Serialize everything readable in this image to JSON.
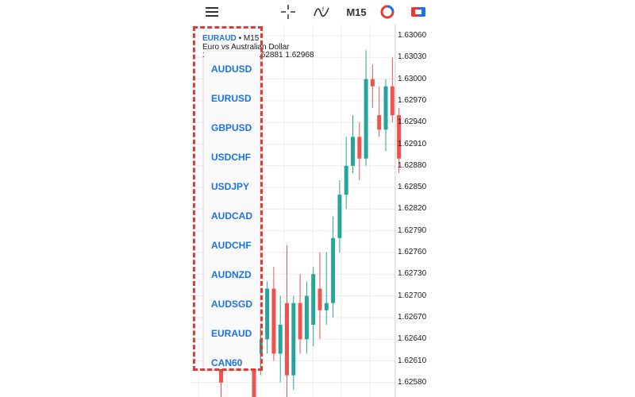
{
  "toolbar": {
    "timeframe": "M15"
  },
  "chart": {
    "symbol": "EURAUD",
    "separator": "•",
    "timeframe": "M15",
    "description": "Euro vs Australian Dollar",
    "ohlc_prefix": "1",
    "ohlc_values": "04 1.62881 1.62968",
    "price_axis": [
      "1.63060",
      "1.63030",
      "1.63000",
      "1.62970",
      "1.62940",
      "1.62910",
      "1.62880",
      "1.62850",
      "1.62820",
      "1.62790",
      "1.62760",
      "1.62730",
      "1.62700",
      "1.62670",
      "1.62640",
      "1.62610",
      "1.62580"
    ]
  },
  "symbol_menu": {
    "items": [
      "AUDUSD",
      "EURUSD",
      "GBPUSD",
      "USDCHF",
      "USDJPY",
      "AUDCAD",
      "AUDCHF",
      "AUDNZD",
      "AUDSGD",
      "EURAUD",
      "CAN60"
    ]
  },
  "colors": {
    "bull": "#26a69a",
    "bear": "#ef5350",
    "grid": "#ececec",
    "accent": "#1a73e8",
    "highlight": "#e53935"
  },
  "chart_data": {
    "type": "candlestick",
    "ylim": [
      1.6256,
      1.6308
    ],
    "candles": [
      {
        "o": 1.626,
        "h": 1.6261,
        "l": 1.6256,
        "c": 1.6258,
        "bull": false
      },
      {
        "o": 1.6272,
        "h": 1.6274,
        "l": 1.627,
        "c": 1.6271,
        "bull": false
      },
      {
        "o": 1.627,
        "h": 1.6272,
        "l": 1.6268,
        "c": 1.6269,
        "bull": false
      },
      {
        "o": 1.6271,
        "h": 1.6273,
        "l": 1.6269,
        "c": 1.627,
        "bull": false
      },
      {
        "o": 1.627,
        "h": 1.6272,
        "l": 1.6263,
        "c": 1.6266,
        "bull": false
      },
      {
        "o": 1.626,
        "h": 1.6264,
        "l": 1.6255,
        "c": 1.6256,
        "bull": false
      },
      {
        "o": 1.6262,
        "h": 1.6266,
        "l": 1.6259,
        "c": 1.6264,
        "bull": true
      },
      {
        "o": 1.6264,
        "h": 1.6272,
        "l": 1.6262,
        "c": 1.6271,
        "bull": true
      },
      {
        "o": 1.6271,
        "h": 1.6274,
        "l": 1.6261,
        "c": 1.6262,
        "bull": false
      },
      {
        "o": 1.6262,
        "h": 1.627,
        "l": 1.6258,
        "c": 1.6266,
        "bull": true
      },
      {
        "o": 1.6269,
        "h": 1.6277,
        "l": 1.6256,
        "c": 1.6259,
        "bull": false
      },
      {
        "o": 1.6259,
        "h": 1.627,
        "l": 1.6257,
        "c": 1.6269,
        "bull": true
      },
      {
        "o": 1.6269,
        "h": 1.6273,
        "l": 1.6262,
        "c": 1.6264,
        "bull": false
      },
      {
        "o": 1.6264,
        "h": 1.6272,
        "l": 1.6262,
        "c": 1.627,
        "bull": true
      },
      {
        "o": 1.6266,
        "h": 1.6274,
        "l": 1.6263,
        "c": 1.6273,
        "bull": true
      },
      {
        "o": 1.6271,
        "h": 1.6276,
        "l": 1.6264,
        "c": 1.6268,
        "bull": false
      },
      {
        "o": 1.6268,
        "h": 1.6276,
        "l": 1.6266,
        "c": 1.6269,
        "bull": true
      },
      {
        "o": 1.6269,
        "h": 1.6281,
        "l": 1.6267,
        "c": 1.6278,
        "bull": true
      },
      {
        "o": 1.6278,
        "h": 1.6286,
        "l": 1.6276,
        "c": 1.6284,
        "bull": true
      },
      {
        "o": 1.6284,
        "h": 1.6292,
        "l": 1.6282,
        "c": 1.6288,
        "bull": true
      },
      {
        "o": 1.6288,
        "h": 1.6295,
        "l": 1.6287,
        "c": 1.6292,
        "bull": true
      },
      {
        "o": 1.6292,
        "h": 1.6294,
        "l": 1.6286,
        "c": 1.6289,
        "bull": false
      },
      {
        "o": 1.6289,
        "h": 1.6304,
        "l": 1.6288,
        "c": 1.63,
        "bull": true
      },
      {
        "o": 1.63,
        "h": 1.6302,
        "l": 1.6296,
        "c": 1.6299,
        "bull": false
      },
      {
        "o": 1.6295,
        "h": 1.6299,
        "l": 1.6292,
        "c": 1.6293,
        "bull": false
      },
      {
        "o": 1.6293,
        "h": 1.63,
        "l": 1.629,
        "c": 1.6299,
        "bull": true
      },
      {
        "o": 1.6299,
        "h": 1.6303,
        "l": 1.6294,
        "c": 1.6295,
        "bull": false
      },
      {
        "o": 1.6295,
        "h": 1.6296,
        "l": 1.6287,
        "c": 1.6289,
        "bull": false
      }
    ]
  }
}
